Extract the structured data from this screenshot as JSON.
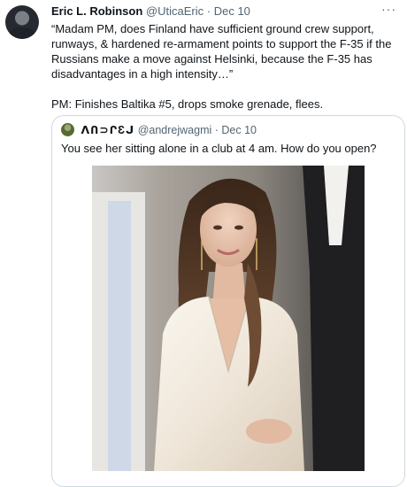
{
  "tweet": {
    "author_name": "Eric L. Robinson",
    "handle": "@UticaEric",
    "separator": "·",
    "date": "Dec 10",
    "more_icon": "more-horizontal-icon",
    "paragraph_1": "“Madam PM, does Finland have sufficient ground crew support, runways, & hardened re-armament points to support the F-35 if the Russians make a move against Helsinki, because the F-35 has disadvantages in a high intensity…”",
    "paragraph_2": "PM: Finishes Baltika #5, drops smoke grenade, flees."
  },
  "quoted_tweet": {
    "author_name": "ᐱՈ⊃ՐƐᒍ",
    "handle": "@andrejwagmi",
    "separator": "·",
    "date": "Dec 10",
    "text": "You see her sitting alone in a club at 4 am. How do you open?"
  }
}
